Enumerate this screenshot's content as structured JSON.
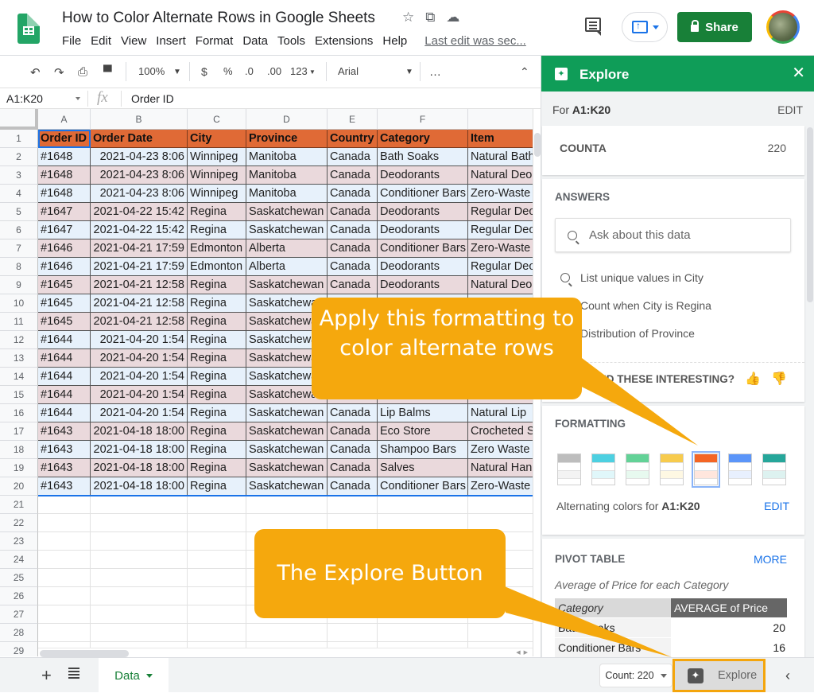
{
  "app": {
    "doc_title": "How to Color Alternate Rows in Google Sheets",
    "menu": [
      "File",
      "Edit",
      "View",
      "Insert",
      "Format",
      "Data",
      "Tools",
      "Extensions",
      "Help"
    ],
    "last_edit": "Last edit was sec...",
    "share_label": "Share"
  },
  "toolbar": {
    "zoom": "100%",
    "currency": "$",
    "percent": "%",
    "dec_decrease": ".0",
    "dec_increase": ".00",
    "number_format": "123",
    "font": "Arial",
    "more": "…"
  },
  "formula_bar": {
    "name_box": "A1:K20",
    "fx": "fx",
    "value": "Order ID"
  },
  "sheet": {
    "columns": [
      "A",
      "B",
      "C",
      "D",
      "E",
      "F",
      ""
    ],
    "header": [
      "Order ID",
      "Order Date",
      "City",
      "Province",
      "Country",
      "Category",
      "Item"
    ],
    "rows": [
      [
        "#1648",
        "2021-04-23 8:06",
        "Winnipeg",
        "Manitoba",
        "Canada",
        "Bath Soaks",
        "Natural Bath"
      ],
      [
        "#1648",
        "2021-04-23 8:06",
        "Winnipeg",
        "Manitoba",
        "Canada",
        "Deodorants",
        "Natural Deo"
      ],
      [
        "#1648",
        "2021-04-23 8:06",
        "Winnipeg",
        "Manitoba",
        "Canada",
        "Conditioner Bars",
        "Zero-Waste"
      ],
      [
        "#1647",
        "2021-04-22 15:42",
        "Regina",
        "Saskatchewan",
        "Canada",
        "Deodorants",
        "Regular Deo"
      ],
      [
        "#1647",
        "2021-04-22 15:42",
        "Regina",
        "Saskatchewan",
        "Canada",
        "Deodorants",
        "Regular Deo"
      ],
      [
        "#1646",
        "2021-04-21 17:59",
        "Edmonton",
        "Alberta",
        "Canada",
        "Conditioner Bars",
        "Zero-Waste"
      ],
      [
        "#1646",
        "2021-04-21 17:59",
        "Edmonton",
        "Alberta",
        "Canada",
        "Deodorants",
        "Regular Deo"
      ],
      [
        "#1645",
        "2021-04-21 12:58",
        "Regina",
        "Saskatchewan",
        "Canada",
        "Deodorants",
        "Natural Deo"
      ],
      [
        "#1645",
        "2021-04-21 12:58",
        "Regina",
        "Saskatchewan",
        "",
        "",
        ""
      ],
      [
        "#1645",
        "2021-04-21 12:58",
        "Regina",
        "Saskatchewan",
        "",
        "",
        ""
      ],
      [
        "#1644",
        "2021-04-20 1:54",
        "Regina",
        "Saskatchewan",
        "",
        "",
        ""
      ],
      [
        "#1644",
        "2021-04-20 1:54",
        "Regina",
        "Saskatchewan",
        "",
        "",
        ""
      ],
      [
        "#1644",
        "2021-04-20 1:54",
        "Regina",
        "Saskatchewan",
        "",
        "",
        ""
      ],
      [
        "#1644",
        "2021-04-20 1:54",
        "Regina",
        "Saskatchewan",
        "",
        "",
        ""
      ],
      [
        "#1644",
        "2021-04-20 1:54",
        "Regina",
        "Saskatchewan",
        "Canada",
        "Lip Balms",
        "Natural Lip"
      ],
      [
        "#1643",
        "2021-04-18 18:00",
        "Regina",
        "Saskatchewan",
        "Canada",
        "Eco Store",
        "Crocheted S"
      ],
      [
        "#1643",
        "2021-04-18 18:00",
        "Regina",
        "Saskatchewan",
        "Canada",
        "Shampoo Bars",
        "Zero Waste"
      ],
      [
        "#1643",
        "2021-04-18 18:00",
        "Regina",
        "Saskatchewan",
        "Canada",
        "Salves",
        "Natural Han"
      ],
      [
        "#1643",
        "2021-04-18 18:00",
        "Regina",
        "Saskatchewan",
        "Canada",
        "Conditioner Bars",
        "Zero-Waste"
      ]
    ],
    "empty_row_numbers": [
      21,
      22,
      23,
      24,
      25,
      26,
      27,
      28,
      29
    ],
    "header_color": "#e06a36",
    "band_color_1": "#e7f1fb",
    "band_color_2": "#ead9dc"
  },
  "bottom": {
    "sheet_tab": "Data",
    "count": "Count: 220",
    "explore": "Explore"
  },
  "explore_panel": {
    "title": "Explore",
    "for_prefix": "For ",
    "range": "A1:K20",
    "edit": "EDIT",
    "counta_label": "COUNTA",
    "counta_value": "220",
    "answers_title": "ANSWERS",
    "ask_placeholder": "Ask about this data",
    "suggestions": [
      "List unique values in City",
      "Count when City is Regina",
      "Distribution of Province"
    ],
    "interesting": "FIND THESE INTERESTING?",
    "formatting_title": "FORMATTING",
    "swatches": [
      {
        "header": "#bdbdbd",
        "band": "#f3f3f3"
      },
      {
        "header": "#4dd0e1",
        "band": "#e0f7fa"
      },
      {
        "header": "#63d297",
        "band": "#e7f9ef"
      },
      {
        "header": "#f7cb4d",
        "band": "#fef8e3"
      },
      {
        "header": "#f46524",
        "band": "#ffe6dd"
      },
      {
        "header": "#5b95f9",
        "band": "#e8f0fe"
      },
      {
        "header": "#26a69a",
        "band": "#ddf2f0"
      }
    ],
    "selected_swatch": 4,
    "alt_prefix": "Alternating colors for ",
    "alt_range": "A1:K20",
    "alt_edit": "EDIT",
    "pivot_title": "PIVOT TABLE",
    "pivot_more": "MORE",
    "pivot_subtitle": "Average of Price for each Category",
    "pivot_headers": [
      "Category",
      "AVERAGE of Price"
    ],
    "pivot_rows": [
      [
        "Bath Soaks",
        "20"
      ],
      [
        "Conditioner Bars",
        "16"
      ]
    ]
  },
  "callouts": {
    "formatting": "Apply this formatting to color alternate rows",
    "explore": "The Explore Button",
    "color": "#f5a80d"
  }
}
